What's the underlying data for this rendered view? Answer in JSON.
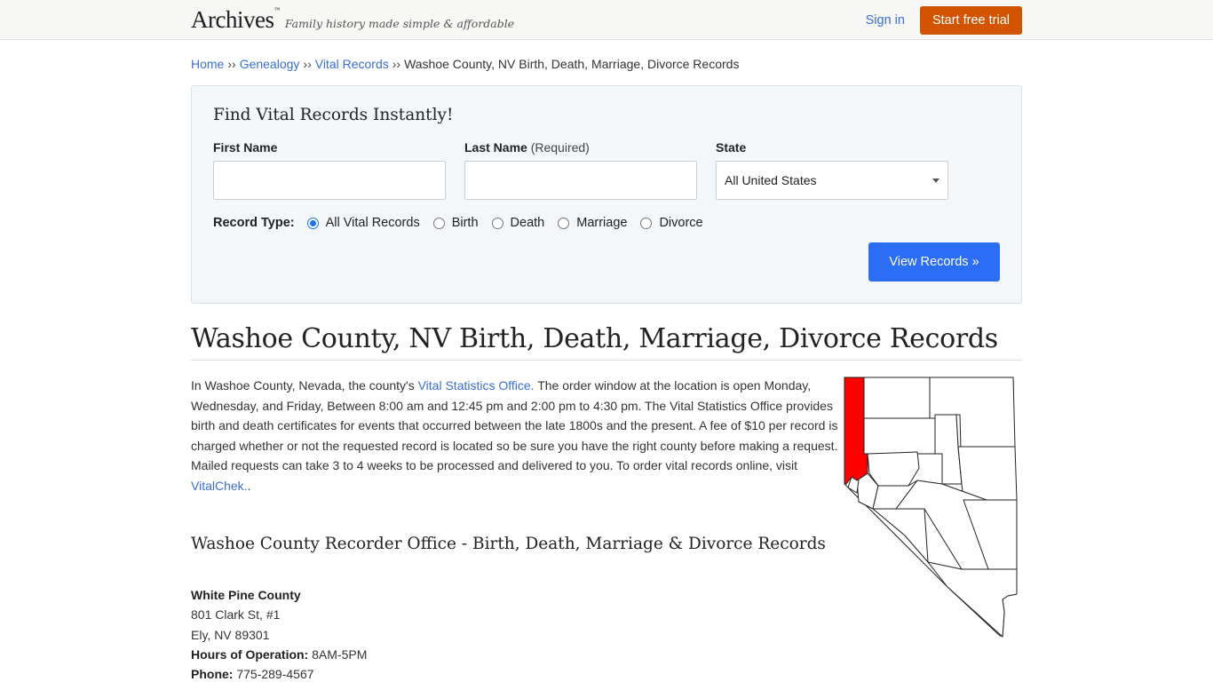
{
  "header": {
    "logo": "Archives",
    "logo_mark": "™",
    "tagline": "Family history made simple & affordable",
    "signin": "Sign in",
    "trial": "Start free trial"
  },
  "breadcrumb": {
    "items": [
      "Home",
      "Genealogy",
      "Vital Records"
    ],
    "separator": "››",
    "current": "Washoe County, NV Birth, Death, Marriage, Divorce Records"
  },
  "search": {
    "title": "Find Vital Records Instantly!",
    "first_name_label": "First Name",
    "last_name_label": "Last Name",
    "last_name_req": "(Required)",
    "state_label": "State",
    "state_value": "All United States",
    "record_type_label": "Record Type:",
    "record_types": [
      "All Vital Records",
      "Birth",
      "Death",
      "Marriage",
      "Divorce"
    ],
    "selected_record_type": "All Vital Records",
    "button": "View Records »"
  },
  "page": {
    "title": "Washoe County, NV Birth, Death, Marriage, Divorce Records",
    "intro_a": "In Washoe County, Nevada, the county's ",
    "intro_link": "Vital Statistics Office.",
    "intro_b": " The order window at the location is open Monday, Wednesday, and Friday, Between 8:00 am and 12:45 pm and 2:00 pm to 4:30 pm. The Vital Statistics Office provides birth and death certificates for events that occurred between the late 1800s and the present. A fee of $10 per record is charged whether or not the requested record is located so be sure you have the right county before making a request. Mailed requests can take 3 to 4 weeks to be processed and delivered to you. To order vital records online, visit ",
    "intro_link2": "VitalChek.",
    "intro_end": ".",
    "subtitle": "Washoe County Recorder Office - Birth, Death, Marriage & Divorce Records"
  },
  "office": {
    "name": "White Pine County",
    "address1": "801 Clark St, #1",
    "address2": "Ely, NV 89301",
    "hours_label": "Hours of Operation:",
    "hours": "8AM-5PM",
    "phone_label": "Phone:",
    "phone": "775-289-4567"
  },
  "map": {
    "highlight_color": "#ff0000",
    "highlighted_county": "Washoe"
  }
}
